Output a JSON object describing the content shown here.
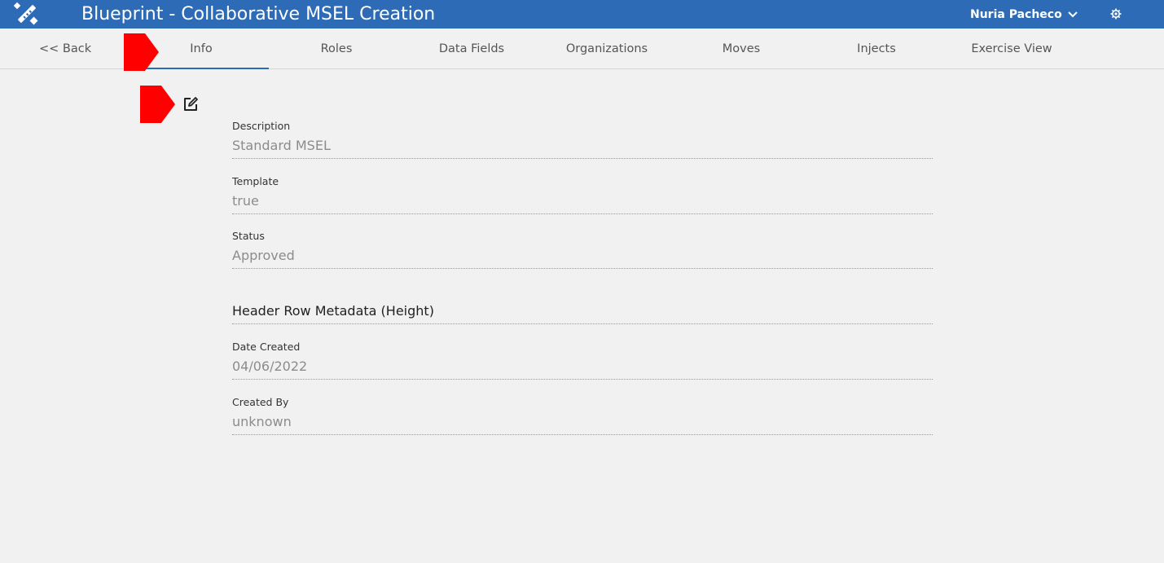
{
  "app": {
    "title": "Blueprint - Collaborative MSEL Creation",
    "user_name": "Nuria Pacheco",
    "brand_color": "#2d6bb7"
  },
  "nav": {
    "back_label": "<< Back",
    "tabs": [
      {
        "label": "Info",
        "active": true
      },
      {
        "label": "Roles"
      },
      {
        "label": "Data Fields"
      },
      {
        "label": "Organizations"
      },
      {
        "label": "Moves"
      },
      {
        "label": "Injects"
      },
      {
        "label": "Exercise View"
      }
    ]
  },
  "fields": [
    {
      "label": "Description",
      "value": "Standard MSEL"
    },
    {
      "label": "Template",
      "value": "true"
    },
    {
      "label": "Status",
      "value": "Approved"
    },
    {
      "label": "Date Created",
      "value": "04/06/2022"
    },
    {
      "label": "Created By",
      "value": "unknown"
    }
  ],
  "section": {
    "title": "Header Row Metadata (Height)"
  },
  "icons": {
    "logo": "blueprint-pencil-ruler-logo",
    "user_menu": "chevron-down-icon",
    "settings": "gear-icon",
    "edit": "edit-icon"
  },
  "marker_color": "#ff0000"
}
